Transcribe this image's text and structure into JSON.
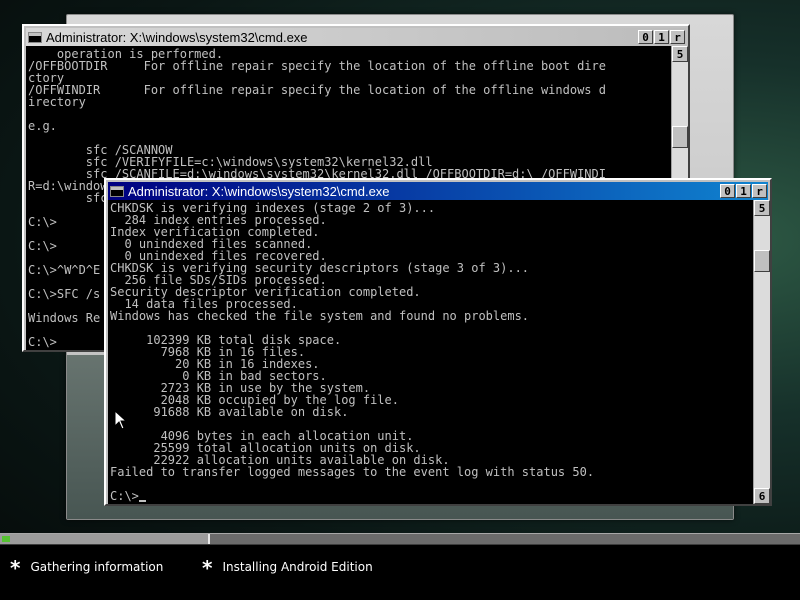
{
  "back_window": {
    "title": "Administrator: X:\\windows\\system32\\cmd.exe",
    "buttons": [
      "0",
      "1",
      "r"
    ],
    "scroll_up": "5",
    "lines": [
      "    operation is performed.",
      "/OFFBOOTDIR     For offline repair specify the location of the offline boot dire",
      "ctory",
      "/OFFWINDIR      For offline repair specify the location of the offline windows d",
      "irectory",
      "",
      "e.g.",
      "",
      "        sfc /SCANNOW",
      "        sfc /VERIFYFILE=c:\\windows\\system32\\kernel32.dll",
      "        sfc /SCANFILE=d:\\windows\\system32\\kernel32.dll /OFFBOOTDIR=d:\\ /OFFWINDI",
      "R=d:\\windows",
      "        sfc",
      "",
      "C:\\>",
      "",
      "C:\\>",
      "",
      "C:\\>^W^D^E",
      "",
      "C:\\>SFC /s",
      "",
      "Windows Re",
      "",
      "C:\\>"
    ]
  },
  "front_window": {
    "title": "Administrator: X:\\windows\\system32\\cmd.exe",
    "buttons": [
      "0",
      "1",
      "r"
    ],
    "scroll_up": "5",
    "scroll_down": "6",
    "lines": [
      "CHKDSK is verifying indexes (stage 2 of 3)...",
      "  284 index entries processed.",
      "Index verification completed.",
      "  0 unindexed files scanned.",
      "  0 unindexed files recovered.",
      "CHKDSK is verifying security descriptors (stage 3 of 3)...",
      "  256 file SDs/SIDs processed.",
      "Security descriptor verification completed.",
      "  14 data files processed.",
      "Windows has checked the file system and found no problems.",
      "",
      "     102399 KB total disk space.",
      "       7968 KB in 16 files.",
      "         20 KB in 16 indexes.",
      "          0 KB in bad sectors.",
      "       2723 KB in use by the system.",
      "       2048 KB occupied by the log file.",
      "      91688 KB available on disk.",
      "",
      "       4096 bytes in each allocation unit.",
      "      25599 total allocation units on disk.",
      "      22922 allocation units available on disk.",
      "Failed to transfer logged messages to the event log with status 50.",
      ""
    ],
    "prompt": "C:\\>"
  },
  "progress": {
    "value_fraction": 0.012,
    "fill_color": "#56c232"
  },
  "steps": [
    {
      "icon": "asterisk-icon",
      "star": "*",
      "label": "Gathering information"
    },
    {
      "icon": "asterisk-icon",
      "star": "*",
      "label": "Installing Android Edition"
    }
  ]
}
